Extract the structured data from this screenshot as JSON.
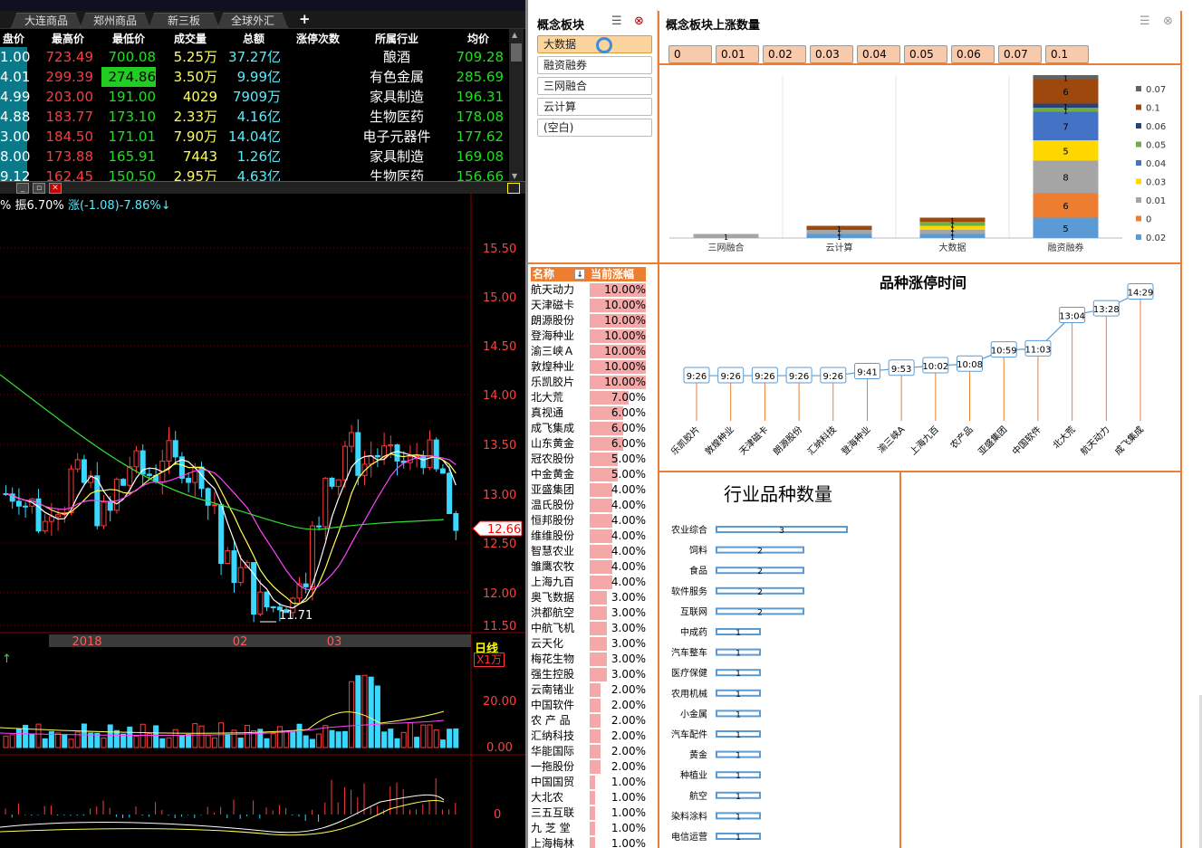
{
  "tabs": [
    "大连商品",
    "郑州商品",
    "新三板",
    "全球外汇",
    "+"
  ],
  "quote_headers": [
    "盘价",
    "最高价",
    "最低价",
    "成交量",
    "总额",
    "涨停次数",
    "所属行业",
    "均价"
  ],
  "quotes": [
    {
      "open": "1.00",
      "high": "723.49",
      "low": "700.08",
      "vol": "5.25万",
      "amt": "37.27亿",
      "ind": "酿酒",
      "avg": "709.28"
    },
    {
      "open": "4.01",
      "high": "299.39",
      "low": "274.86",
      "vol": "3.50万",
      "amt": "9.99亿",
      "ind": "有色金属",
      "avg": "285.69"
    },
    {
      "open": "4.99",
      "high": "203.00",
      "low": "191.00",
      "vol": "4029",
      "amt": "7909万",
      "ind": "家具制造",
      "avg": "196.31"
    },
    {
      "open": "4.88",
      "high": "183.77",
      "low": "173.10",
      "vol": "2.33万",
      "amt": "4.16亿",
      "ind": "生物医药",
      "avg": "178.08"
    },
    {
      "open": "3.00",
      "high": "184.50",
      "low": "171.01",
      "vol": "7.90万",
      "amt": "14.04亿",
      "ind": "电子元器件",
      "avg": "177.62"
    },
    {
      "open": "8.00",
      "high": "173.88",
      "low": "165.91",
      "vol": "7443",
      "amt": "1.26亿",
      "ind": "家具制造",
      "avg": "169.08"
    },
    {
      "open": "9.12",
      "high": "162.45",
      "low": "150.50",
      "vol": "2.95万",
      "amt": "4.63亿",
      "ind": "生物医药",
      "avg": "156.66"
    }
  ],
  "chart_info": {
    "amp": "% 振6.70%",
    "chg": "涨(-1.08)-7.86%↓"
  },
  "price_axis": [
    "15.50",
    "15.00",
    "14.50",
    "14.00",
    "13.50",
    "13.00",
    "12.50",
    "12.00",
    "11.50"
  ],
  "price_tag": "12.66",
  "low_label": "11.71",
  "date_axis": [
    "2018",
    "02",
    "03"
  ],
  "period_label": "日线",
  "vol_unit": "X1万",
  "vol_axis": [
    "20.00",
    "0.00"
  ],
  "macd_axis": "0",
  "concept": {
    "title": "概念板块",
    "items": [
      "大数据",
      "融资融券",
      "三网融合",
      "云计算",
      "(空白)"
    ]
  },
  "rise_count": {
    "title": "概念板块上涨数量",
    "filters": [
      "0",
      "0.01",
      "0.02",
      "0.03",
      "0.04",
      "0.05",
      "0.06",
      "0.07",
      "0.1"
    ]
  },
  "stock_list": {
    "headers": [
      "名称",
      "当前涨幅"
    ],
    "rows": [
      {
        "n": "航天动力",
        "v": "10.00%",
        "p": 10
      },
      {
        "n": "天津磁卡",
        "v": "10.00%",
        "p": 10
      },
      {
        "n": "朗源股份",
        "v": "10.00%",
        "p": 10
      },
      {
        "n": "登海种业",
        "v": "10.00%",
        "p": 10
      },
      {
        "n": "渝三峡Ａ",
        "v": "10.00%",
        "p": 10
      },
      {
        "n": "敦煌种业",
        "v": "10.00%",
        "p": 10
      },
      {
        "n": "乐凯胶片",
        "v": "10.00%",
        "p": 10
      },
      {
        "n": "北大荒",
        "v": "7.00%",
        "p": 7
      },
      {
        "n": "真视通",
        "v": "6.00%",
        "p": 6
      },
      {
        "n": "成飞集成",
        "v": "6.00%",
        "p": 6
      },
      {
        "n": "山东黄金",
        "v": "6.00%",
        "p": 6
      },
      {
        "n": "冠农股份",
        "v": "5.00%",
        "p": 5
      },
      {
        "n": "中金黄金",
        "v": "5.00%",
        "p": 5
      },
      {
        "n": "亚盛集团",
        "v": "4.00%",
        "p": 4
      },
      {
        "n": "温氏股份",
        "v": "4.00%",
        "p": 4
      },
      {
        "n": "恒邦股份",
        "v": "4.00%",
        "p": 4
      },
      {
        "n": "维维股份",
        "v": "4.00%",
        "p": 4
      },
      {
        "n": "智慧农业",
        "v": "4.00%",
        "p": 4
      },
      {
        "n": "雏鹰农牧",
        "v": "4.00%",
        "p": 4
      },
      {
        "n": "上海九百",
        "v": "4.00%",
        "p": 4
      },
      {
        "n": "奥飞数据",
        "v": "3.00%",
        "p": 3
      },
      {
        "n": "洪都航空",
        "v": "3.00%",
        "p": 3
      },
      {
        "n": "中航飞机",
        "v": "3.00%",
        "p": 3
      },
      {
        "n": "云天化",
        "v": "3.00%",
        "p": 3
      },
      {
        "n": "梅花生物",
        "v": "3.00%",
        "p": 3
      },
      {
        "n": "强生控股",
        "v": "3.00%",
        "p": 3
      },
      {
        "n": "云南锗业",
        "v": "2.00%",
        "p": 2
      },
      {
        "n": "中国软件",
        "v": "2.00%",
        "p": 2
      },
      {
        "n": "农 产 品",
        "v": "2.00%",
        "p": 2
      },
      {
        "n": "汇纳科技",
        "v": "2.00%",
        "p": 2
      },
      {
        "n": "华能国际",
        "v": "2.00%",
        "p": 2
      },
      {
        "n": "一拖股份",
        "v": "2.00%",
        "p": 2
      },
      {
        "n": "中国国贸",
        "v": "1.00%",
        "p": 1
      },
      {
        "n": "大北农",
        "v": "1.00%",
        "p": 1
      },
      {
        "n": "三五互联",
        "v": "1.00%",
        "p": 1
      },
      {
        "n": "九 芝 堂",
        "v": "1.00%",
        "p": 1
      },
      {
        "n": "上海梅林",
        "v": "1.00%",
        "p": 1
      }
    ]
  },
  "chart_data": [
    {
      "type": "bar",
      "stacked": true,
      "categories": [
        "三网融合",
        "云计算",
        "大数据",
        "融资融券"
      ],
      "legend": [
        "0.07",
        "0.1",
        "0.06",
        "0.05",
        "0.04",
        "0.03",
        "0.01",
        "0",
        "0.02"
      ],
      "colors": {
        "0.02": "#5b9bd5",
        "0": "#ed7d31",
        "0.01": "#a5a5a5",
        "0.03": "#ffd700",
        "0.04": "#4472c4",
        "0.05": "#70ad47",
        "0.06": "#264478",
        "0.1": "#9e480e",
        "0.07": "#636363"
      },
      "series": [
        {
          "name": "0.02",
          "values": [
            0,
            1,
            1,
            5
          ]
        },
        {
          "name": "0",
          "values": [
            0,
            0,
            0,
            6
          ]
        },
        {
          "name": "0.01",
          "values": [
            1,
            1,
            1,
            8
          ]
        },
        {
          "name": "0.03",
          "values": [
            0,
            0,
            1,
            5
          ]
        },
        {
          "name": "0.04",
          "values": [
            0,
            0,
            0,
            7
          ]
        },
        {
          "name": "0.05",
          "values": [
            0,
            0,
            1,
            1
          ]
        },
        {
          "name": "0.06",
          "values": [
            0,
            0,
            0,
            1
          ]
        },
        {
          "name": "0.1",
          "values": [
            0,
            1,
            1,
            6
          ]
        },
        {
          "name": "0.07",
          "values": [
            0,
            0,
            0,
            1
          ]
        }
      ]
    },
    {
      "type": "line",
      "title": "品种涨停时间",
      "categories": [
        "乐凯胶片",
        "敦煌种业",
        "天津磁卡",
        "朗源股份",
        "汇纳科技",
        "登海种业",
        "渝三峡A",
        "上海九百",
        "农产品",
        "亚盛集团",
        "中国软件",
        "北大荒",
        "航天动力",
        "成飞集成"
      ],
      "labels": [
        "9:26",
        "9:26",
        "9:26",
        "9:26",
        "9:26",
        "9:41",
        "9:53",
        "10:02",
        "10:08",
        "10:59",
        "11:03",
        "13:04",
        "13:28",
        "14:29"
      ],
      "values": [
        566,
        566,
        566,
        566,
        566,
        581,
        593,
        602,
        608,
        659,
        663,
        784,
        808,
        869
      ]
    },
    {
      "type": "bar",
      "orientation": "horizontal",
      "title": "行业品种数量",
      "categories": [
        "农业综合",
        "饲料",
        "食品",
        "软件服务",
        "互联网",
        "中成药",
        "汽车整车",
        "医疗保健",
        "农用机械",
        "小金属",
        "汽车配件",
        "黄金",
        "种植业",
        "航空",
        "染料涂料",
        "电信运营"
      ],
      "values": [
        3,
        2,
        2,
        2,
        2,
        1,
        1,
        1,
        1,
        1,
        1,
        1,
        1,
        1,
        1,
        1
      ]
    }
  ],
  "colors": {
    "accent": "#ed7d31",
    "pink": "#f7caac",
    "bar_blue": "#5b9bd5"
  }
}
